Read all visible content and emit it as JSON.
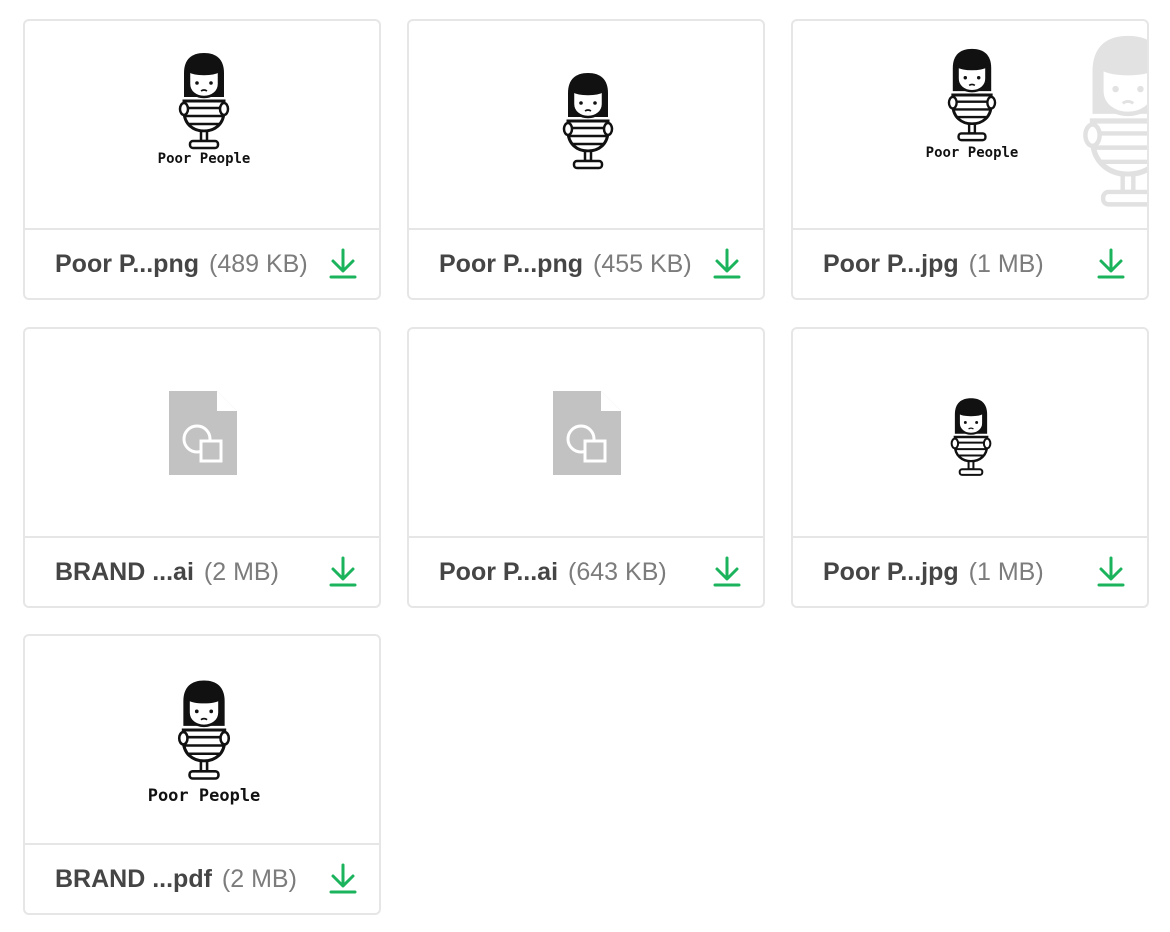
{
  "colors": {
    "border": "#e6e6e6",
    "name_text": "#454545",
    "size_text": "#7c7c7c",
    "download_icon": "#1bb35c",
    "file_icon": "#c2c2c2"
  },
  "files": [
    {
      "name": "Poor P...png",
      "size": "(489 KB)",
      "preview": "logo-with-text",
      "logo_text": "Poor People",
      "download_icon": "download-icon"
    },
    {
      "name": "Poor P...png",
      "size": "(455 KB)",
      "preview": "logo-only",
      "download_icon": "download-icon"
    },
    {
      "name": "Poor P...jpg",
      "size": "(1 MB)",
      "preview": "logo-with-text",
      "logo_text": "Poor People",
      "download_icon": "download-icon"
    },
    {
      "name": "BRAND ...ai",
      "size": "(2 MB)",
      "preview": "generic-file-icon",
      "download_icon": "download-icon"
    },
    {
      "name": "Poor P...ai",
      "size": "(643 KB)",
      "preview": "generic-file-icon",
      "download_icon": "download-icon"
    },
    {
      "name": "Poor P...jpg",
      "size": "(1 MB)",
      "preview": "logo-only",
      "download_icon": "download-icon"
    },
    {
      "name": "BRAND ...pdf",
      "size": "(2 MB)",
      "preview": "logo-with-text",
      "logo_text": "Poor People",
      "download_icon": "download-icon"
    }
  ]
}
